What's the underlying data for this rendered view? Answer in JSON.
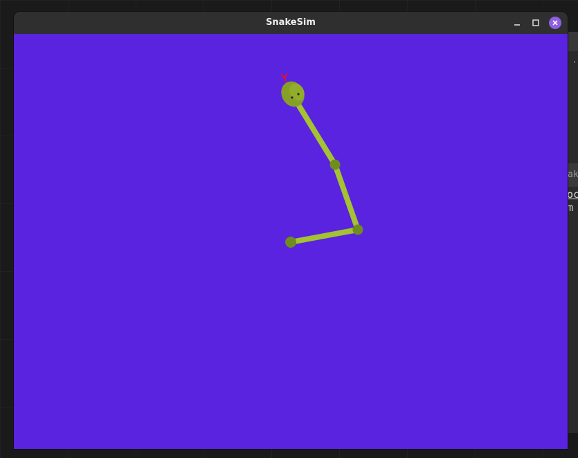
{
  "window": {
    "title": "SnakeSim",
    "controls": {
      "minimize": "minimize-icon",
      "maximize": "maximize-icon",
      "close": "close-icon"
    }
  },
  "background_terminal": {
    "lines": [
      "··",
      "ak",
      "oc",
      "m"
    ]
  },
  "scene": {
    "background_color": "#5923df",
    "snake": {
      "body_color": "#a4c232",
      "joint_color": "#6f8c1e",
      "head_color": "#869f28",
      "tongue_color": "#d4143c",
      "eye_color": "#2a2a10"
    }
  }
}
